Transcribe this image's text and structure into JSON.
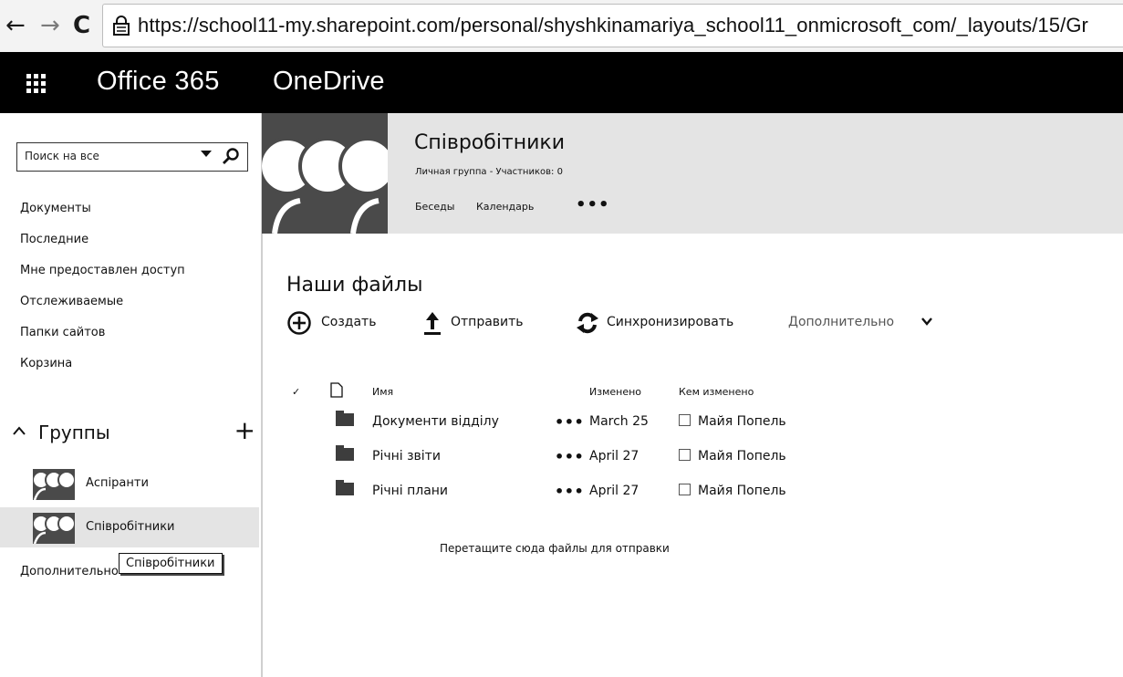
{
  "browser": {
    "url": "https://school11-my.sharepoint.com/personal/shyshkinamariya_school11_onmicrosoft_com/_layouts/15/Gr"
  },
  "suite": {
    "brand": "Office 365",
    "app": "OneDrive"
  },
  "leftnav": {
    "search_placeholder": "Поиск на все",
    "items": [
      {
        "label": "Документы"
      },
      {
        "label": "Последние"
      },
      {
        "label": "Мне предоставлен доступ"
      },
      {
        "label": "Отслеживаемые"
      },
      {
        "label": "Папки сайтов"
      },
      {
        "label": "Корзина"
      }
    ],
    "groups_title": "Группы",
    "groups_add": "+",
    "groups": [
      {
        "label": "Аспіранти"
      },
      {
        "label": "Співробітники"
      }
    ],
    "more": "Дополнительно",
    "tooltip": "Співробітники"
  },
  "group": {
    "title": "Співробітники",
    "meta": "Личная группа - Участников: 0",
    "links": [
      "Беседы",
      "Календарь"
    ],
    "more_dots": "•••"
  },
  "files": {
    "title": "Наши файлы",
    "commands": {
      "create": "Создать",
      "upload": "Отправить",
      "sync": "Синхронизировать",
      "more": "Дополнительно"
    },
    "columns": {
      "check": "✓",
      "name": "Имя",
      "modified": "Изменено",
      "modified_by": "Кем изменено"
    },
    "rows": [
      {
        "name": "Документи відділу",
        "dots": "•••",
        "modified": "March 25",
        "by": "Майя Попель"
      },
      {
        "name": "Річні звіти",
        "dots": "•••",
        "modified": "April 27",
        "by": "Майя Попель"
      },
      {
        "name": "Річні плани",
        "dots": "•••",
        "modified": "April 27",
        "by": "Майя Попель"
      }
    ],
    "dropzone": "Перетащите сюда файлы для отправки"
  },
  "icons": {
    "back": "arrow-left",
    "forward": "arrow-right",
    "reload": "reload",
    "lock": "lock",
    "waffle": "app-launcher",
    "search": "magnifier",
    "create": "plus-circle",
    "upload": "upload-arrow",
    "sync": "sync-arrows",
    "folder": "folder",
    "doc": "document",
    "group_avatar": "people"
  },
  "colors": {
    "suitebar": "#000000",
    "hero": "#e4e4e4",
    "selected_group": "#e4e4e4",
    "group_image": "#4a4a4a"
  }
}
